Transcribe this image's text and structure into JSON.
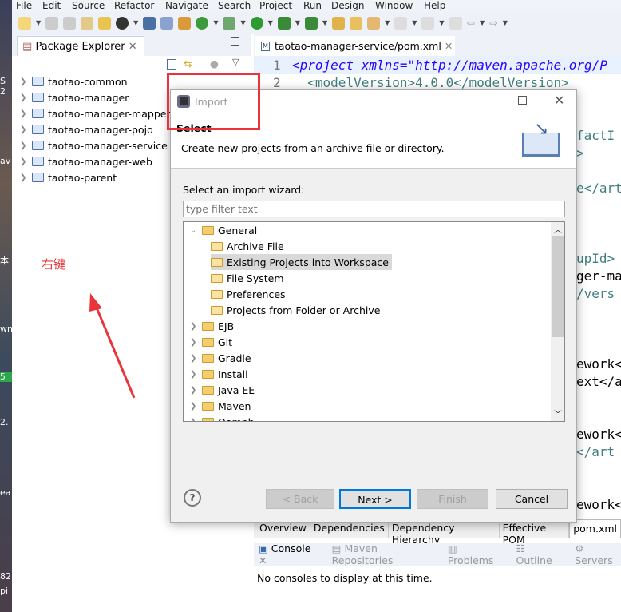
{
  "menu": [
    "File",
    "Edit",
    "Source",
    "Refactor",
    "Navigate",
    "Search",
    "Project",
    "Run",
    "Design",
    "Window",
    "Help"
  ],
  "desktop_fragments": [
    "S 2",
    "av",
    "本",
    "wnl",
    "5",
    "2.",
    "ea",
    "82",
    "pi"
  ],
  "package_explorer": {
    "title": "Package Explorer",
    "projects": [
      "taotao-common",
      "taotao-manager",
      "taotao-manager-mapper",
      "taotao-manager-pojo",
      "taotao-manager-service",
      "taotao-manager-web",
      "taotao-parent"
    ]
  },
  "annotation": {
    "text": "右键",
    "color": "#e83a3a"
  },
  "editor": {
    "tab": "taotao-manager-service/pom.xml",
    "lines": [
      {
        "no": "1",
        "text": "<project xmlns=\"http://maven.apache.org/P"
      },
      {
        "no": "2",
        "text": "  <modelVersion>4.0.0</modelVersion>"
      }
    ],
    "fragments": [
      "factI",
      ">",
      "e</art",
      "upId>",
      "ger-map",
      "/vers",
      "ework<",
      "ext</a",
      "ework<",
      "</art",
      "ework<"
    ],
    "bottom_tabs": [
      "Overview",
      "Dependencies",
      "Dependency Hierarchy",
      "Effective POM",
      "pom.xml"
    ]
  },
  "console": {
    "tabs": [
      "Console",
      "Maven Repositories",
      "Problems",
      "Outline",
      "Servers"
    ],
    "message": "No consoles to display at this time."
  },
  "dialog": {
    "title": "Import",
    "heading": "Select",
    "description": "Create new projects from an archive file or directory.",
    "wizard_label": "Select an import wizard:",
    "filter_placeholder": "type filter text",
    "tree": [
      {
        "label": "General",
        "expanded": true,
        "children": [
          "Archive File",
          "Existing Projects into Workspace",
          "File System",
          "Preferences",
          "Projects from Folder or Archive"
        ]
      },
      {
        "label": "EJB"
      },
      {
        "label": "Git"
      },
      {
        "label": "Gradle"
      },
      {
        "label": "Install"
      },
      {
        "label": "Java EE"
      },
      {
        "label": "Maven"
      },
      {
        "label": "Oomph"
      }
    ],
    "selected": "Existing Projects into Workspace",
    "buttons": {
      "back": "< Back",
      "next": "Next >",
      "finish": "Finish",
      "cancel": "Cancel"
    }
  },
  "colors": {
    "highlight_box": "#e8343a",
    "accent": "#0078d7"
  }
}
